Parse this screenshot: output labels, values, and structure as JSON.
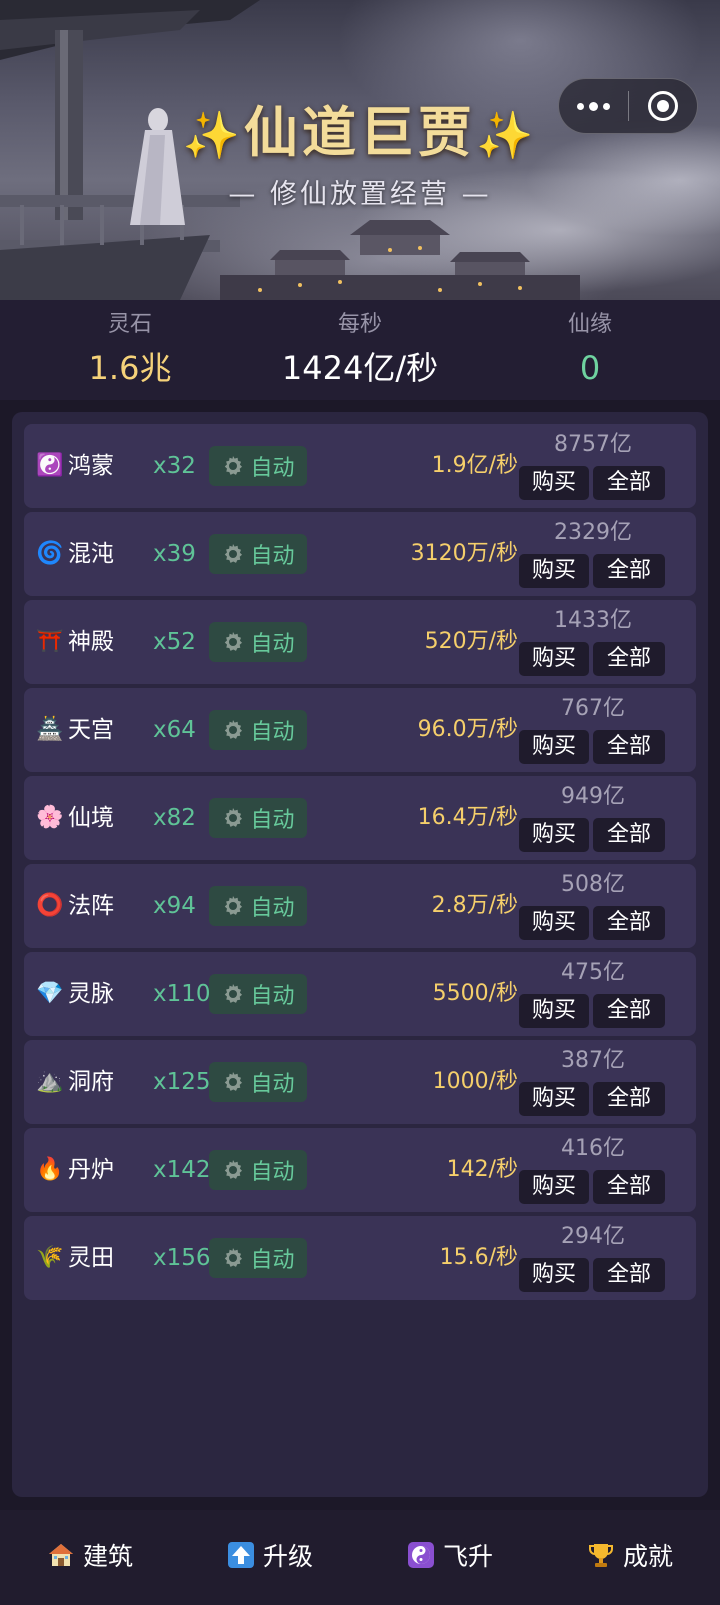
{
  "header": {
    "title": "仙道巨贾",
    "title_spark_left": "✨",
    "title_spark_right": "✨",
    "subtitle": "— 修仙放置经营 —"
  },
  "capsule": {
    "more_icon": "more-dots-icon",
    "close_icon": "miniprogram-close-icon"
  },
  "stats": {
    "stones": {
      "label": "灵石",
      "value": "1.6兆"
    },
    "per_second": {
      "label": "每秒",
      "value": "1424亿/秒"
    },
    "fate": {
      "label": "仙缘",
      "value": "0"
    }
  },
  "colors": {
    "gold": "#f5d27a",
    "green": "#5fc397",
    "row_bg": "#3a3356",
    "panel_bg": "#2b2640",
    "auto_bg": "#2e4a42"
  },
  "buildings": [
    {
      "icon": "☯️",
      "icon_name": "yin-yang-icon",
      "name": "鸿蒙",
      "count": "x32",
      "auto": "自动",
      "rate": "1.9亿/秒",
      "cost": "8757亿",
      "buy": "购买",
      "all": "全部"
    },
    {
      "icon": "🌀",
      "icon_name": "cyclone-icon",
      "name": "混沌",
      "count": "x39",
      "auto": "自动",
      "rate": "3120万/秒",
      "cost": "2329亿",
      "buy": "购买",
      "all": "全部"
    },
    {
      "icon": "⛩️",
      "icon_name": "shrine-gate-icon",
      "name": "神殿",
      "count": "x52",
      "auto": "自动",
      "rate": "520万/秒",
      "cost": "1433亿",
      "buy": "购买",
      "all": "全部"
    },
    {
      "icon": "🏯",
      "icon_name": "palace-icon",
      "name": "天宫",
      "count": "x64",
      "auto": "自动",
      "rate": "96.0万/秒",
      "cost": "767亿",
      "buy": "购买",
      "all": "全部"
    },
    {
      "icon": "🌸",
      "icon_name": "blossom-icon",
      "name": "仙境",
      "count": "x82",
      "auto": "自动",
      "rate": "16.4万/秒",
      "cost": "949亿",
      "buy": "购买",
      "all": "全部"
    },
    {
      "icon": "⭕",
      "icon_name": "circle-icon",
      "name": "法阵",
      "count": "x94",
      "auto": "自动",
      "rate": "2.8万/秒",
      "cost": "508亿",
      "buy": "购买",
      "all": "全部"
    },
    {
      "icon": "💎",
      "icon_name": "gem-icon",
      "name": "灵脉",
      "count": "x110",
      "auto": "自动",
      "rate": "5500/秒",
      "cost": "475亿",
      "buy": "购买",
      "all": "全部"
    },
    {
      "icon": "⛰️",
      "icon_name": "mountain-icon",
      "name": "洞府",
      "count": "x125",
      "auto": "自动",
      "rate": "1000/秒",
      "cost": "387亿",
      "buy": "购买",
      "all": "全部"
    },
    {
      "icon": "🔥",
      "icon_name": "fire-icon",
      "name": "丹炉",
      "count": "x142",
      "auto": "自动",
      "rate": "142/秒",
      "cost": "416亿",
      "buy": "购买",
      "all": "全部"
    },
    {
      "icon": "🌾",
      "icon_name": "rice-icon",
      "name": "灵田",
      "count": "x156",
      "auto": "自动",
      "rate": "15.6/秒",
      "cost": "294亿",
      "buy": "购买",
      "all": "全部"
    }
  ],
  "nav": {
    "building": {
      "icon_name": "house-icon",
      "label": "建筑"
    },
    "upgrade": {
      "icon_name": "up-arrow-icon",
      "label": "升级"
    },
    "ascend": {
      "icon_name": "yin-yang-icon",
      "label": "飞升"
    },
    "achievement": {
      "icon_name": "trophy-icon",
      "label": "成就"
    }
  }
}
